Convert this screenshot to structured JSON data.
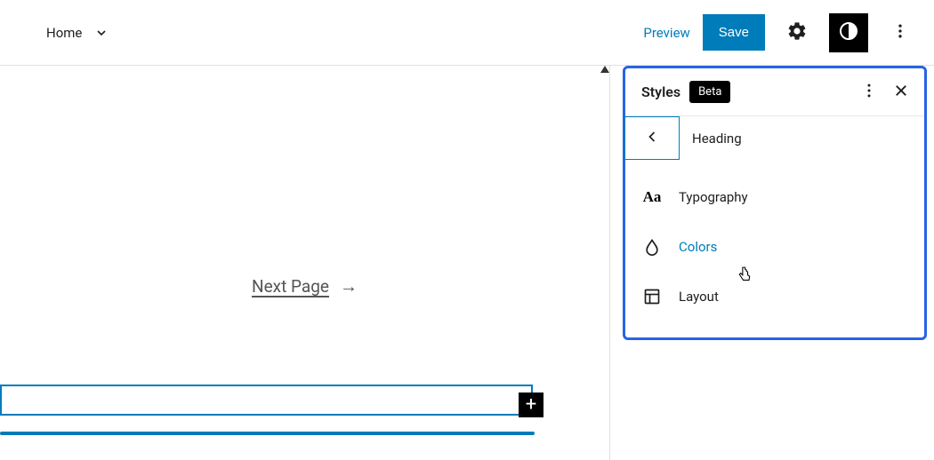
{
  "topbar": {
    "home_label": "Home",
    "preview_label": "Preview",
    "save_label": "Save"
  },
  "canvas": {
    "next_page_label": "Next Page"
  },
  "panel": {
    "title": "Styles",
    "badge": "Beta",
    "back_heading": "Heading",
    "items": {
      "typography": "Typography",
      "colors": "Colors",
      "layout": "Layout"
    }
  }
}
